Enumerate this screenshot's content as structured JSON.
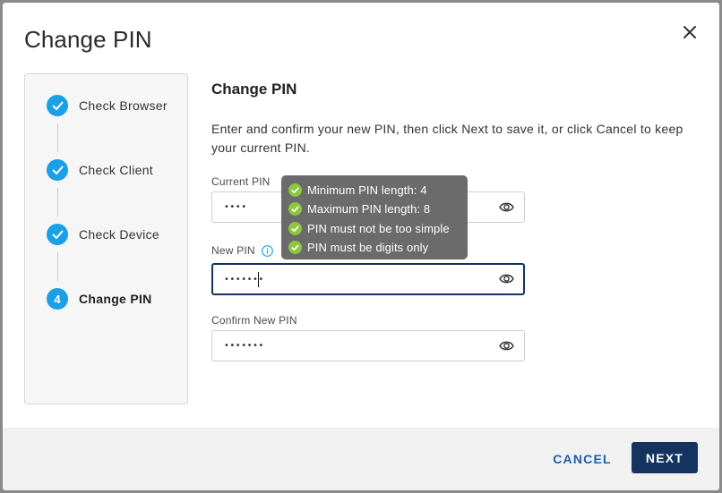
{
  "dialog": {
    "title": "Change PIN"
  },
  "stepper": {
    "steps": [
      {
        "label": "Check Browser",
        "status": "completed",
        "icon": "check-icon"
      },
      {
        "label": "Check Client",
        "status": "completed",
        "icon": "check-icon"
      },
      {
        "label": "Check Device",
        "status": "completed",
        "icon": "check-icon"
      },
      {
        "label": "Change PIN",
        "status": "active",
        "number": "4"
      }
    ]
  },
  "form": {
    "title": "Change PIN",
    "description": "Enter and confirm your new PIN, then click Next to save it, or click Cancel to keep your current PIN.",
    "current_pin": {
      "label": "Current PIN",
      "value": "••••"
    },
    "new_pin": {
      "label": "New PIN",
      "value": "•••••••"
    },
    "confirm_pin": {
      "label": "Confirm New PIN",
      "value": "•••••••"
    }
  },
  "tooltip": {
    "rules": [
      "Minimum PIN length: 4",
      "Maximum PIN length: 8",
      "PIN must not be too simple",
      "PIN must be digits only"
    ]
  },
  "footer": {
    "cancel_label": "CANCEL",
    "next_label": "NEXT"
  },
  "colors": {
    "accent": "#1aa0e6",
    "primary_button": "#14335f",
    "cancel_text": "#1f5fa8",
    "tooltip_check": "#8dc63f"
  }
}
